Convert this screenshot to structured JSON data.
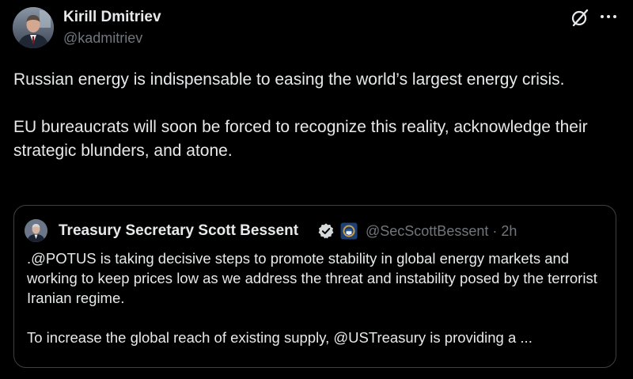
{
  "author": {
    "name": "Kirill Dmitriev",
    "handle": "@kadmitriev"
  },
  "tweet": {
    "paragraphs": [
      "Russian energy is indispensable to easing the world’s largest energy crisis.",
      "EU bureaucrats will soon be forced to recognize this reality, acknowledge their strategic blunders, and atone."
    ]
  },
  "quote": {
    "name": "Treasury Secretary Scott Bessent",
    "handle": "@SecScottBessent",
    "separator": "·",
    "time": "2h",
    "paragraphs": [
      ".@POTUS is taking decisive steps to promote stability in global energy markets and working to keep prices low as we address the threat and instability posed by the terrorist Iranian regime.",
      "To increase the global reach of existing supply, @USTreasury is providing a ..."
    ]
  },
  "icons": {
    "header_action": "grok-icon",
    "overflow_menu": "more-icon",
    "verified": "verified-icon",
    "affiliate_badge": "gov-badge-icon"
  },
  "colors": {
    "background": "#000000",
    "text_primary": "#e7e9ea",
    "text_secondary": "#71767b",
    "border": "#3e4144",
    "verified_badge": "#d6d9db"
  }
}
